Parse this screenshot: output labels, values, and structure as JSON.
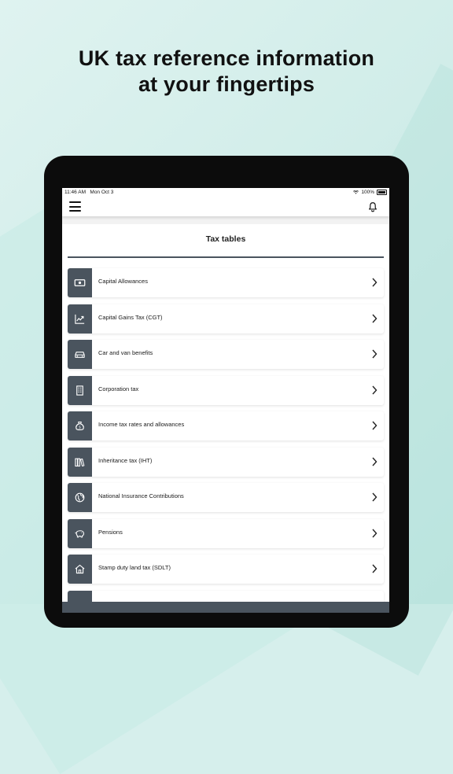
{
  "headline": {
    "line1": "UK tax reference information",
    "line2": "at your fingertips"
  },
  "status": {
    "time": "11:46 AM",
    "date": "Mon Oct 3",
    "battery": "100%"
  },
  "nav": {
    "menu_icon": "hamburger-menu-icon",
    "bell_icon": "bell-icon"
  },
  "page": {
    "title": "Tax tables"
  },
  "items": [
    {
      "label": "Capital Allowances",
      "icon": "banknote-icon"
    },
    {
      "label": "Capital Gains Tax (CGT)",
      "icon": "trend-chart-icon"
    },
    {
      "label": "Car and van benefits",
      "icon": "car-icon"
    },
    {
      "label": "Corporation tax",
      "icon": "building-icon"
    },
    {
      "label": "Income tax rates and allowances",
      "icon": "money-bag-icon"
    },
    {
      "label": "Inheritance tax (IHT)",
      "icon": "books-icon"
    },
    {
      "label": "National Insurance Contributions",
      "icon": "globe-icon"
    },
    {
      "label": "Pensions",
      "icon": "piggy-bank-icon"
    },
    {
      "label": "Stamp duty land tax (SDLT)",
      "icon": "house-icon"
    }
  ],
  "colors": {
    "accent": "#4a545e",
    "background": "#d6efec"
  }
}
